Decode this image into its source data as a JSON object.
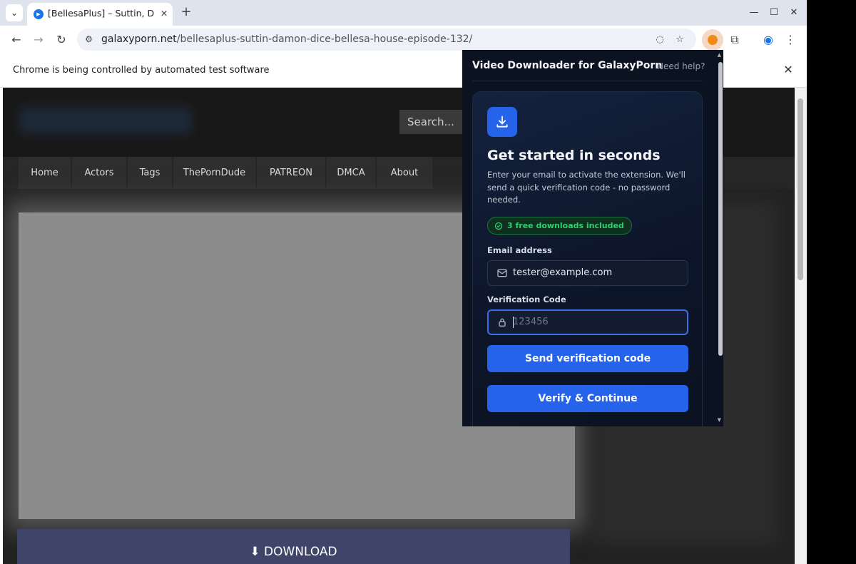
{
  "browser": {
    "tab": {
      "title": "[BellesaPlus] – Suttin, Da"
    },
    "url_domain": "galaxyporn.net",
    "url_path": "/bellesaplus-suttin-damon-dice-bellesa-house-episode-132/",
    "infobar_text": "Chrome is being controlled by automated test software"
  },
  "site": {
    "search_placeholder": "Search...",
    "nav": [
      "Home",
      "Actors",
      "Tags",
      "ThePornDude",
      "PATREON",
      "DMCA",
      "About"
    ],
    "download_label": "DOWNLOAD"
  },
  "popup": {
    "header": "Video Downloader for GalaxyPorn",
    "help_link": "Need help?",
    "title": "Get started in seconds",
    "description": "Enter your email to activate the extension. We'll send a quick verification code - no password needed.",
    "badge": "3 free downloads included",
    "email_label": "Email address",
    "email_value": "tester@example.com",
    "code_label": "Verification Code",
    "code_placeholder": "123456",
    "send_button": "Send verification code",
    "verify_button": "Verify & Continue"
  },
  "colors": {
    "accent": "#2563eb",
    "success": "#2fd070",
    "popup_bg": "#0b1220"
  }
}
